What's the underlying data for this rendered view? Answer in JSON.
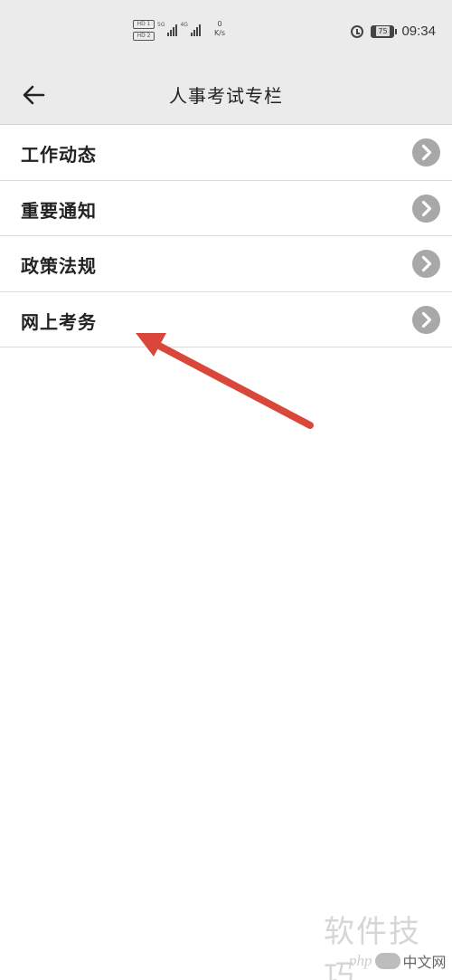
{
  "status_bar": {
    "sim1_badge": "HD 1",
    "sim2_badge": "HD 2",
    "sim1_network": "5G",
    "sim2_network": "4G",
    "speed_value": "0",
    "speed_unit": "K/s",
    "battery": "75",
    "time": "09:34",
    "icons": [
      "alarm-icon",
      "battery-icon",
      "signal-icon"
    ]
  },
  "header": {
    "title": "人事考试专栏",
    "back_icon": "arrow-left-icon",
    "background": "#ebebeb"
  },
  "menu": {
    "items": [
      {
        "label": "工作动态",
        "icon": "chevron-right-icon"
      },
      {
        "label": "重要通知",
        "icon": "chevron-right-icon"
      },
      {
        "label": "政策法规",
        "icon": "chevron-right-icon"
      },
      {
        "label": "网上考务",
        "icon": "chevron-right-icon"
      }
    ],
    "chevron_color": "#a8a8a8"
  },
  "annotation": {
    "type": "arrow",
    "color": "#d9473b",
    "points_to": "网上考务"
  },
  "watermark": {
    "text": "软件技巧",
    "logo_text": "php",
    "logo_suffix": "中文网"
  }
}
